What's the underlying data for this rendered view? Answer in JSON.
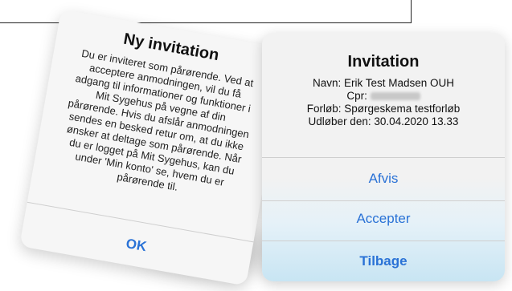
{
  "background_dialog": {
    "title": "Ny invitation",
    "lines": [
      "Du er inviteret som pårørende. Ved at",
      "acceptere anmodningen, vil du få",
      "adgang til informationer og funktioner i",
      "Mit Sygehus på vegne af din",
      "pårørende. Hvis du afslår anmodningen",
      "sendes en besked retur om, at du ikke",
      "ønsker at deltage som pårørende. Når",
      "du er logget på Mit Sygehus, kan du",
      "under 'Min konto' se, hvem du er",
      "pårørende til."
    ],
    "ok_label": "OK"
  },
  "dialog": {
    "title": "Invitation",
    "name_line": "Navn: Erik Test Madsen OUH",
    "cpr_label": "Cpr:",
    "course_line": "Forløb: Spørgeskema testforløb",
    "expiry_line": "Udløber den: 30.04.2020 13.33",
    "reject_label": "Afvis",
    "accept_label": "Accepter",
    "back_label": "Tilbage"
  },
  "colors": {
    "accent": "#2a72d6",
    "button_fade": "#c8e5f3"
  }
}
